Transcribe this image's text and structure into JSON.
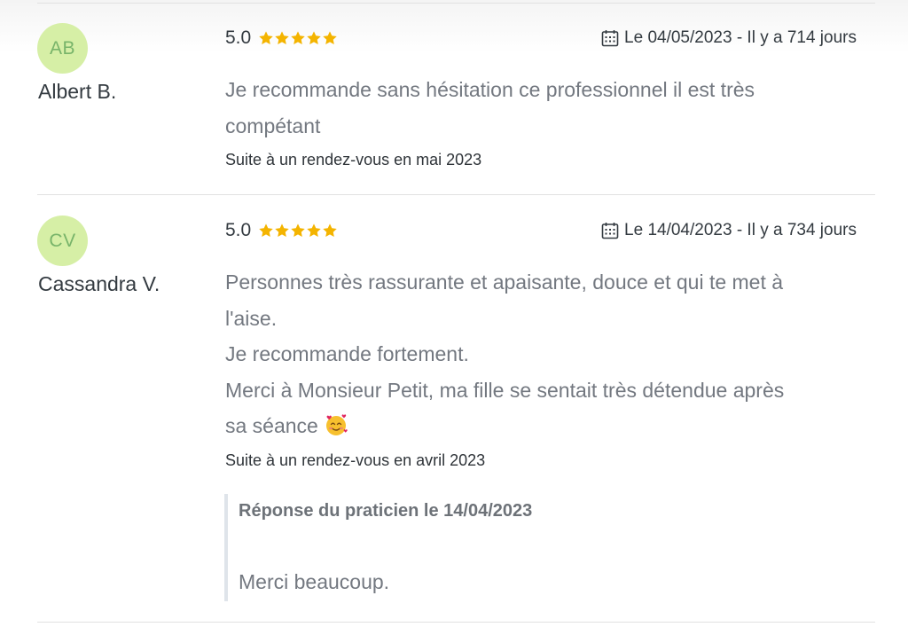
{
  "reviews": [
    {
      "initials": "AB",
      "author": "Albert B.",
      "rating": "5.0",
      "stars": 5,
      "date": "Le 04/05/2023 - Il y a 714 jours",
      "comment_lines": [
        "Je recommande  sans hésitation ce professionnel  il est très",
        "compétant"
      ],
      "visit": "Suite à un rendez-vous en mai 2023"
    },
    {
      "initials": "CV",
      "author": "Cassandra V.",
      "rating": "5.0",
      "stars": 5,
      "date": "Le 14/04/2023 - Il y a 734 jours",
      "comment_lines": [
        "Personnes très rassurante et apaisante, douce et qui te met à",
        "l'aise.",
        "Je recommande fortement.",
        "Merci à Monsieur Petit, ma fille se sentait très détendue après",
        "sa séance"
      ],
      "comment_emoji": "smiling-face-with-hearts-icon",
      "visit": "Suite à un rendez-vous en avril 2023",
      "reply": {
        "title": "Réponse du praticien le 14/04/2023",
        "text": "Merci beaucoup."
      }
    }
  ],
  "colors": {
    "avatar_bg": "#d6efa6",
    "avatar_text": "#78b46a",
    "star": "#f4b400",
    "comment_text": "#737880",
    "divider": "#e2e2e2"
  }
}
